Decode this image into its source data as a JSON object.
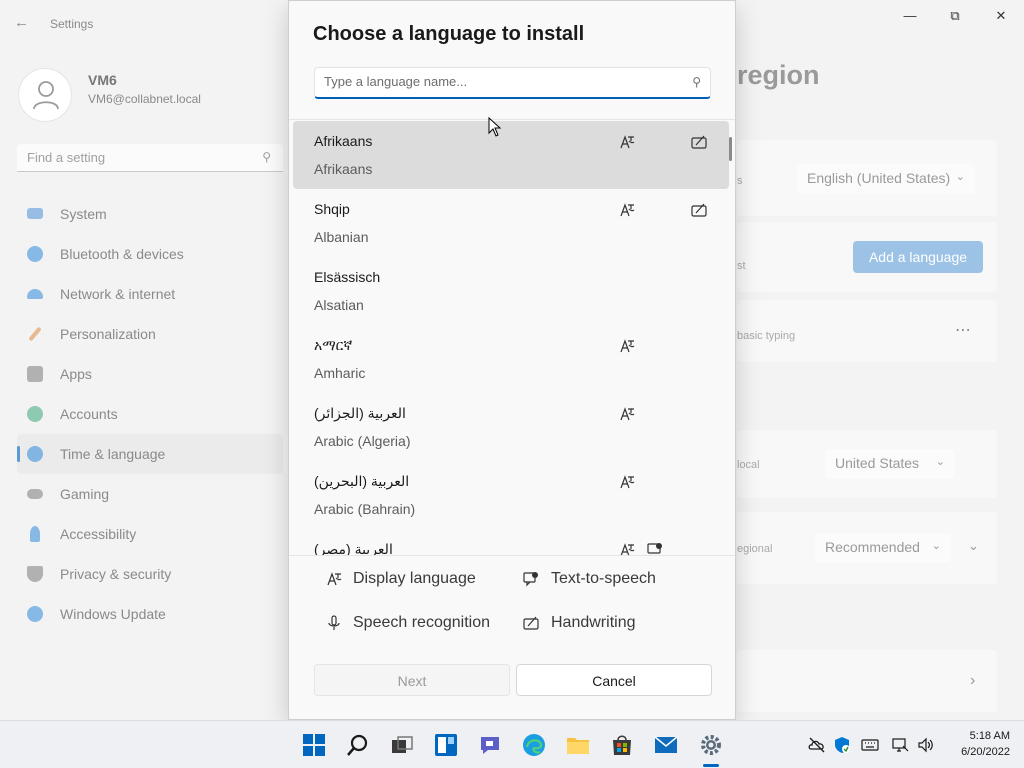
{
  "window": {
    "app_title": "Settings",
    "page_heading_partial": "region"
  },
  "profile": {
    "name": "VM6",
    "email": "VM6@collabnet.local"
  },
  "sidebar": {
    "search_placeholder": "Find a setting",
    "items": [
      {
        "label": "System",
        "icon": "system-icon",
        "color": "#4a90d9"
      },
      {
        "label": "Bluetooth & devices",
        "icon": "bluetooth-icon",
        "color": "#2b88d8"
      },
      {
        "label": "Network & internet",
        "icon": "wifi-icon",
        "color": "#2b88d8"
      },
      {
        "label": "Personalization",
        "icon": "brush-icon",
        "color": "#e08a3c"
      },
      {
        "label": "Apps",
        "icon": "apps-icon",
        "color": "#7a7a7a"
      },
      {
        "label": "Accounts",
        "icon": "person-icon",
        "color": "#3aa57a"
      },
      {
        "label": "Time & language",
        "icon": "globe-clock-icon",
        "color": "#2b88d8",
        "active": true
      },
      {
        "label": "Gaming",
        "icon": "gamepad-icon",
        "color": "#7a7a7a"
      },
      {
        "label": "Accessibility",
        "icon": "accessibility-icon",
        "color": "#2b88d8"
      },
      {
        "label": "Privacy & security",
        "icon": "shield-icon",
        "color": "#7a7a7a"
      },
      {
        "label": "Windows Update",
        "icon": "update-icon",
        "color": "#2b88d8"
      }
    ]
  },
  "background": {
    "windows_display_language": "English (United States)",
    "add_language_label": "Add a language",
    "text_basic_typing": "basic typing",
    "text_st": "st",
    "text_s": "s",
    "country_label_partial": "local",
    "country_value": "United States",
    "regional_label_partial": "egional",
    "regional_format_value": "Recommended"
  },
  "dialog": {
    "title": "Choose a language to install",
    "search_placeholder": "Type a language name...",
    "languages": [
      {
        "native": "Afrikaans",
        "english": "Afrikaans",
        "display": true,
        "handwriting": true,
        "selected": true
      },
      {
        "native": "Shqip",
        "english": "Albanian",
        "display": true,
        "handwriting": true,
        "selected": false
      },
      {
        "native": "Elsässisch",
        "english": "Alsatian",
        "display": false,
        "handwriting": false,
        "selected": false
      },
      {
        "native": "አማርኛ",
        "english": "Amharic",
        "display": true,
        "handwriting": false,
        "selected": false
      },
      {
        "native": "العربية (الجزائر)",
        "english": "Arabic (Algeria)",
        "display": true,
        "handwriting": false,
        "selected": false
      },
      {
        "native": "العربية (البحرين)",
        "english": "Arabic (Bahrain)",
        "display": true,
        "handwriting": false,
        "selected": false
      },
      {
        "native": "العربية (مصر)",
        "english": "",
        "display": true,
        "handwriting": false,
        "selected": false
      }
    ],
    "legend": {
      "display_language": "Display language",
      "text_to_speech": "Text-to-speech",
      "speech_recognition": "Speech recognition",
      "handwriting": "Handwriting"
    },
    "next_label": "Next",
    "cancel_label": "Cancel"
  },
  "taskbar": {
    "time": "5:18 AM",
    "date": "6/20/2022",
    "accent": "#0067c0"
  }
}
